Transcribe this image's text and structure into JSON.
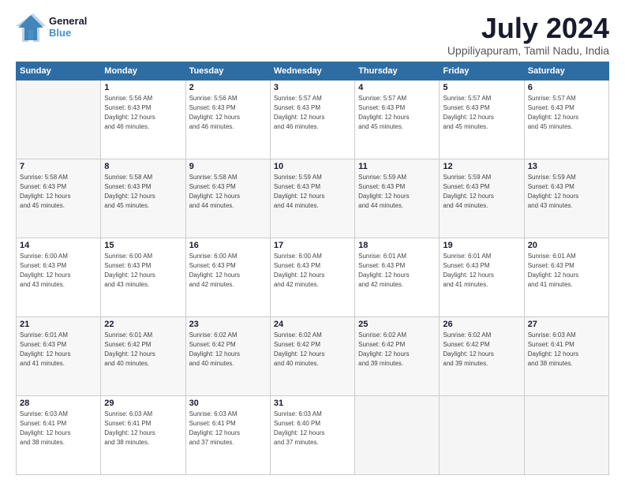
{
  "logo": {
    "line1": "General",
    "line2": "Blue"
  },
  "title": "July 2024",
  "subtitle": "Uppiliyapuram, Tamil Nadu, India",
  "days_header": [
    "Sunday",
    "Monday",
    "Tuesday",
    "Wednesday",
    "Thursday",
    "Friday",
    "Saturday"
  ],
  "weeks": [
    [
      {
        "day": "",
        "info": ""
      },
      {
        "day": "1",
        "info": "Sunrise: 5:56 AM\nSunset: 6:43 PM\nDaylight: 12 hours\nand 46 minutes."
      },
      {
        "day": "2",
        "info": "Sunrise: 5:56 AM\nSunset: 6:43 PM\nDaylight: 12 hours\nand 46 minutes."
      },
      {
        "day": "3",
        "info": "Sunrise: 5:57 AM\nSunset: 6:43 PM\nDaylight: 12 hours\nand 46 minutes."
      },
      {
        "day": "4",
        "info": "Sunrise: 5:57 AM\nSunset: 6:43 PM\nDaylight: 12 hours\nand 45 minutes."
      },
      {
        "day": "5",
        "info": "Sunrise: 5:57 AM\nSunset: 6:43 PM\nDaylight: 12 hours\nand 45 minutes."
      },
      {
        "day": "6",
        "info": "Sunrise: 5:57 AM\nSunset: 6:43 PM\nDaylight: 12 hours\nand 45 minutes."
      }
    ],
    [
      {
        "day": "7",
        "info": "Sunrise: 5:58 AM\nSunset: 6:43 PM\nDaylight: 12 hours\nand 45 minutes."
      },
      {
        "day": "8",
        "info": "Sunrise: 5:58 AM\nSunset: 6:43 PM\nDaylight: 12 hours\nand 45 minutes."
      },
      {
        "day": "9",
        "info": "Sunrise: 5:58 AM\nSunset: 6:43 PM\nDaylight: 12 hours\nand 44 minutes."
      },
      {
        "day": "10",
        "info": "Sunrise: 5:59 AM\nSunset: 6:43 PM\nDaylight: 12 hours\nand 44 minutes."
      },
      {
        "day": "11",
        "info": "Sunrise: 5:59 AM\nSunset: 6:43 PM\nDaylight: 12 hours\nand 44 minutes."
      },
      {
        "day": "12",
        "info": "Sunrise: 5:59 AM\nSunset: 6:43 PM\nDaylight: 12 hours\nand 44 minutes."
      },
      {
        "day": "13",
        "info": "Sunrise: 5:59 AM\nSunset: 6:43 PM\nDaylight: 12 hours\nand 43 minutes."
      }
    ],
    [
      {
        "day": "14",
        "info": "Sunrise: 6:00 AM\nSunset: 6:43 PM\nDaylight: 12 hours\nand 43 minutes."
      },
      {
        "day": "15",
        "info": "Sunrise: 6:00 AM\nSunset: 6:43 PM\nDaylight: 12 hours\nand 43 minutes."
      },
      {
        "day": "16",
        "info": "Sunrise: 6:00 AM\nSunset: 6:43 PM\nDaylight: 12 hours\nand 42 minutes."
      },
      {
        "day": "17",
        "info": "Sunrise: 6:00 AM\nSunset: 6:43 PM\nDaylight: 12 hours\nand 42 minutes."
      },
      {
        "day": "18",
        "info": "Sunrise: 6:01 AM\nSunset: 6:43 PM\nDaylight: 12 hours\nand 42 minutes."
      },
      {
        "day": "19",
        "info": "Sunrise: 6:01 AM\nSunset: 6:43 PM\nDaylight: 12 hours\nand 41 minutes."
      },
      {
        "day": "20",
        "info": "Sunrise: 6:01 AM\nSunset: 6:43 PM\nDaylight: 12 hours\nand 41 minutes."
      }
    ],
    [
      {
        "day": "21",
        "info": "Sunrise: 6:01 AM\nSunset: 6:43 PM\nDaylight: 12 hours\nand 41 minutes."
      },
      {
        "day": "22",
        "info": "Sunrise: 6:01 AM\nSunset: 6:42 PM\nDaylight: 12 hours\nand 40 minutes."
      },
      {
        "day": "23",
        "info": "Sunrise: 6:02 AM\nSunset: 6:42 PM\nDaylight: 12 hours\nand 40 minutes."
      },
      {
        "day": "24",
        "info": "Sunrise: 6:02 AM\nSunset: 6:42 PM\nDaylight: 12 hours\nand 40 minutes."
      },
      {
        "day": "25",
        "info": "Sunrise: 6:02 AM\nSunset: 6:42 PM\nDaylight: 12 hours\nand 39 minutes."
      },
      {
        "day": "26",
        "info": "Sunrise: 6:02 AM\nSunset: 6:42 PM\nDaylight: 12 hours\nand 39 minutes."
      },
      {
        "day": "27",
        "info": "Sunrise: 6:03 AM\nSunset: 6:41 PM\nDaylight: 12 hours\nand 38 minutes."
      }
    ],
    [
      {
        "day": "28",
        "info": "Sunrise: 6:03 AM\nSunset: 6:41 PM\nDaylight: 12 hours\nand 38 minutes."
      },
      {
        "day": "29",
        "info": "Sunrise: 6:03 AM\nSunset: 6:41 PM\nDaylight: 12 hours\nand 38 minutes."
      },
      {
        "day": "30",
        "info": "Sunrise: 6:03 AM\nSunset: 6:41 PM\nDaylight: 12 hours\nand 37 minutes."
      },
      {
        "day": "31",
        "info": "Sunrise: 6:03 AM\nSunset: 6:40 PM\nDaylight: 12 hours\nand 37 minutes."
      },
      {
        "day": "",
        "info": ""
      },
      {
        "day": "",
        "info": ""
      },
      {
        "day": "",
        "info": ""
      }
    ]
  ]
}
